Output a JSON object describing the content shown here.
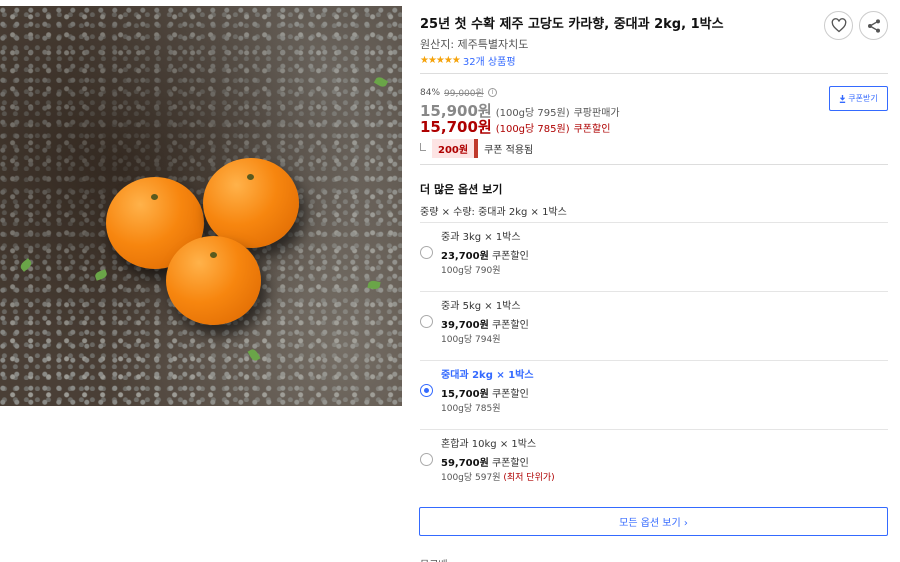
{
  "product": {
    "title": "25년 첫 수확 제주 고당도 카라향, 중대과 2kg, 1박스",
    "origin": "원산지: 제주특별자치도",
    "stars": "★★★★★",
    "review_count": "32개 상품평",
    "rating_value": 5
  },
  "pricing": {
    "discount_rate": "84%",
    "original_price": "99,000원",
    "info_glyph": "i",
    "sale_price": "15,900원",
    "sale_unit": "(100g당 795원)",
    "sale_label": "쿠팡판매가",
    "coupon_price": "15,700원",
    "coupon_unit": "(100g당 785원)",
    "coupon_label": "쿠폰할인",
    "coupon_amount": "200원",
    "coupon_applied": "쿠폰 적용됨",
    "coupon_button": "쿠폰받기"
  },
  "options": {
    "heading": "더 많은 옵션 보기",
    "selected_line": "중량 × 수량: 중대과 2kg × 1박스",
    "items": [
      {
        "name": "중과 3kg × 1박스",
        "price": "23,700원",
        "price_label": "쿠폰할인",
        "unit": "100g당 790원",
        "note": "",
        "selected": false
      },
      {
        "name": "중과 5kg × 1박스",
        "price": "39,700원",
        "price_label": "쿠폰할인",
        "unit": "100g당 794원",
        "note": "",
        "selected": false
      },
      {
        "name": "중대과 2kg × 1박스",
        "price": "15,700원",
        "price_label": "쿠폰할인",
        "unit": "100g당 785원",
        "note": "",
        "selected": true
      },
      {
        "name": "혼합과 10kg × 1박스",
        "price": "59,700원",
        "price_label": "쿠폰할인",
        "unit": "100g당 597원",
        "note": "(최저 단위가)",
        "selected": false
      }
    ],
    "all_button": "모든 옵션 보기 ›"
  },
  "footer_cut": "무료배송",
  "icons": [
    "heart-icon",
    "share-icon",
    "download-icon",
    "info-icon"
  ],
  "colors": {
    "accent": "#346aff",
    "price_red": "#ae0000",
    "star": "#f5a30c"
  }
}
